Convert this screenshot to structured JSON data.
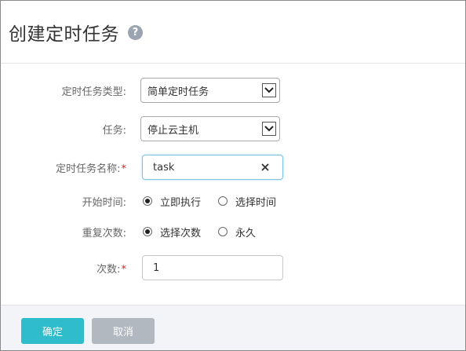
{
  "dialog": {
    "title": "创建定时任务",
    "help_icon": "?"
  },
  "form": {
    "task_type": {
      "label": "定时任务类型:",
      "value": "简单定时任务"
    },
    "task": {
      "label": "任务:",
      "value": "停止云主机"
    },
    "task_name": {
      "label": "定时任务名称:",
      "required_mark": "*",
      "value": "task"
    },
    "start_time": {
      "label": "开始时间:",
      "options": [
        "立即执行",
        "选择时间"
      ],
      "selected": "立即执行"
    },
    "repeat_count": {
      "label": "重复次数:",
      "options": [
        "选择次数",
        "永久"
      ],
      "selected": "选择次数"
    },
    "count": {
      "label": "次数:",
      "required_mark": "*",
      "value": "1"
    }
  },
  "footer": {
    "ok_label": "确定",
    "cancel_label": "取消"
  },
  "colors": {
    "primary_button": "#2fbccb",
    "secondary_button": "#b2b8c0",
    "required": "#e02424",
    "footer_bg": "#f2f4f7"
  },
  "icons": [
    "question-icon",
    "chevron-down-icon",
    "clear-icon"
  ]
}
